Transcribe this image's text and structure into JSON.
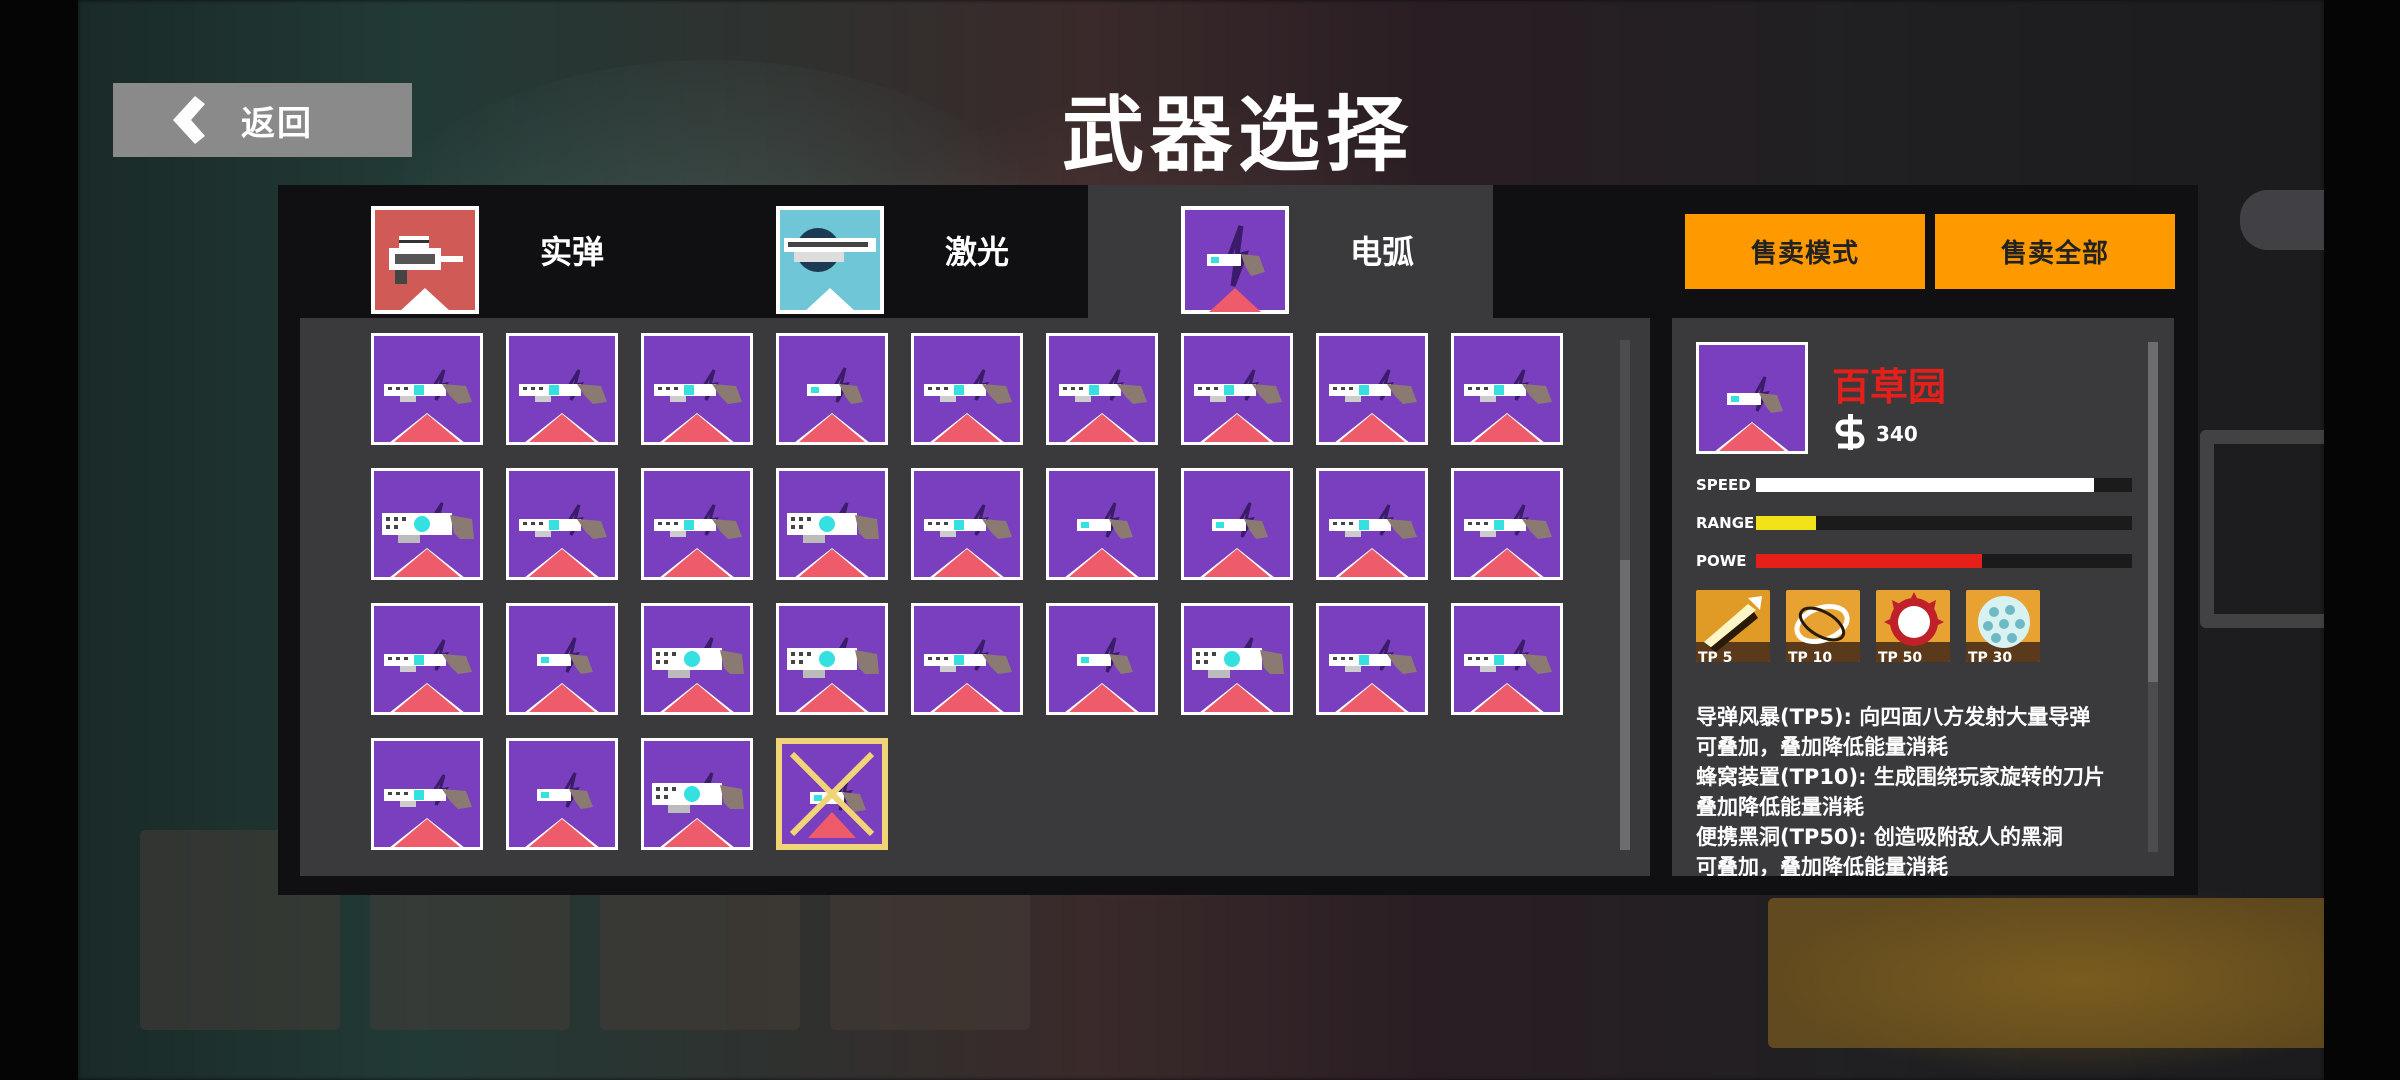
{
  "header": {
    "back_label": "返回",
    "title": "武器选择"
  },
  "tabs": [
    {
      "label": "实弹",
      "icon": "rifle-icon",
      "icon_bg": "#cf5a56",
      "active": false
    },
    {
      "label": "激光",
      "icon": "laser-gun-icon",
      "icon_bg": "#6fc6d6",
      "active": false
    },
    {
      "label": "电弧",
      "icon": "arc-gun-icon",
      "icon_bg": "#7a3fbe",
      "active": true
    }
  ],
  "actions": {
    "sell_mode": "售卖模式",
    "sell_all": "售卖全部"
  },
  "weapon_grid": {
    "slot_color": "#7a3fbe",
    "rows": [
      [
        "long",
        "long",
        "long",
        "short",
        "long",
        "long",
        "long",
        "long",
        "long"
      ],
      [
        "big",
        "long",
        "long",
        "big",
        "long",
        "short",
        "short",
        "long",
        "long"
      ],
      [
        "long",
        "short",
        "big",
        "big",
        "long",
        "short",
        "big",
        "long",
        "long"
      ],
      [
        "long",
        "short",
        "big",
        "short"
      ]
    ],
    "selected": {
      "row": 3,
      "col": 3
    }
  },
  "detail": {
    "name": "百草园",
    "price": "340",
    "stats": [
      {
        "label": "SPEED",
        "value": 0.9,
        "color": "#ffffff"
      },
      {
        "label": "RANGE",
        "value": 0.16,
        "color": "#f2e21a"
      },
      {
        "label": "POWE",
        "value": 0.6,
        "color": "#e5201b"
      }
    ],
    "skills": [
      {
        "tp": "TP 5",
        "icon": "missile-storm-icon",
        "bg": "#e09a26"
      },
      {
        "tp": "TP 10",
        "icon": "blade-swarm-icon",
        "bg": "#e8a232"
      },
      {
        "tp": "TP 50",
        "icon": "black-hole-icon",
        "bg": "#e8a232"
      },
      {
        "tp": "TP 30",
        "icon": "orb-shield-icon",
        "bg": "#e8a232"
      }
    ],
    "description": [
      "导弹风暴(TP5): 向四面八方发射大量导弹",
      "可叠加，叠加降低能量消耗",
      "蜂窝装置(TP10): 生成围绕玩家旋转的刀片",
      "叠加降低能量消耗",
      "便携黑洞(TP50): 创造吸附敌人的黑洞",
      "可叠加，叠加降低能量消耗"
    ]
  }
}
